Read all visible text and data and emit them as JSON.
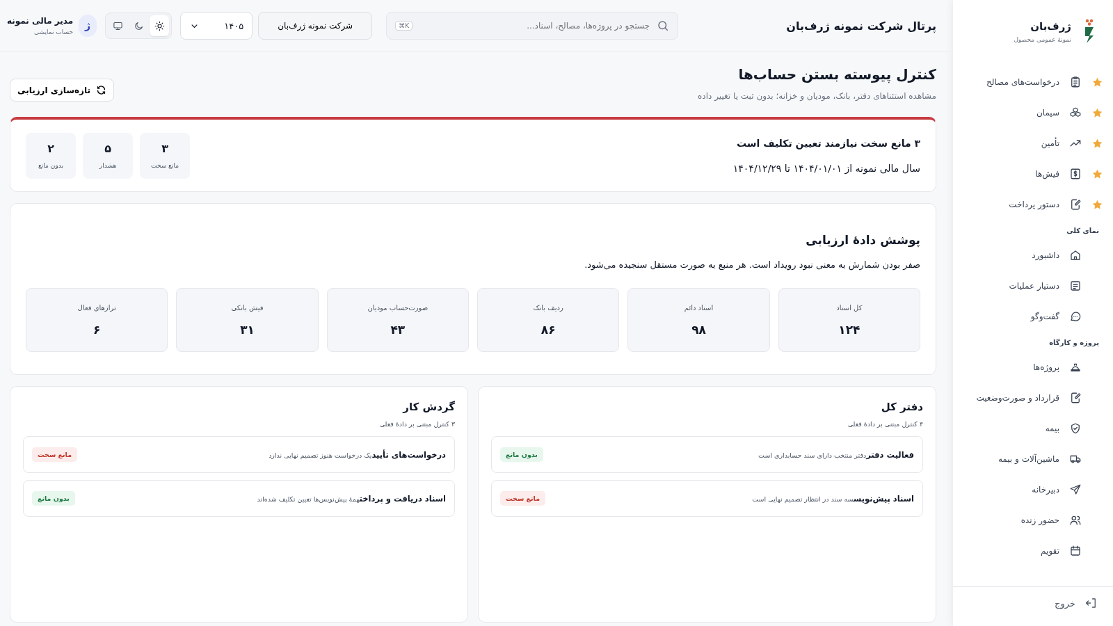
{
  "sidebar": {
    "brand": {
      "name": "ژرف‌بان",
      "tagline": "نمونهٔ عمومی محصول"
    },
    "sections": [
      {
        "items": [
          {
            "label": "درخواست‌های مصالح",
            "starred": true
          },
          {
            "label": "سیمان",
            "starred": true
          },
          {
            "label": "تأمین",
            "starred": true
          },
          {
            "label": "فیش‌ها",
            "starred": true
          },
          {
            "label": "دستور پرداخت",
            "starred": true
          }
        ]
      },
      {
        "title": "نمای کلی",
        "items": [
          {
            "label": "داشبورد",
            "starred": false
          },
          {
            "label": "دستیار عملیات",
            "starred": false
          },
          {
            "label": "گفت‌وگو",
            "starred": false
          }
        ]
      },
      {
        "title": "پروژه و کارگاه",
        "items": [
          {
            "label": "پروژه‌ها",
            "starred": false
          },
          {
            "label": "قرارداد و صورت‌وضعیت",
            "starred": false
          },
          {
            "label": "بیمه",
            "starred": false
          },
          {
            "label": "ماشین‌آلات و بیمه",
            "starred": false
          },
          {
            "label": "دبیرخانه",
            "starred": false
          },
          {
            "label": "حضور زنده",
            "starred": false
          },
          {
            "label": "تقویم",
            "starred": false
          }
        ]
      }
    ],
    "logout": "خروج"
  },
  "header": {
    "title": "پرتال شرکت نمونه ژرف‌بان",
    "search": {
      "placeholder": "جستجو در پروژه‌ها، مصالح، اسناد...",
      "shortcut": "⌘K"
    },
    "company": "شرکت نمونه ژرف‌بان",
    "year": "۱۴۰۵",
    "theme_options": [
      {
        "selected": true
      },
      {
        "selected": false
      },
      {
        "selected": false
      }
    ],
    "user": {
      "avatar": "ژ",
      "name": "مدیر مالی نمونه",
      "role": "حساب نمایشی"
    }
  },
  "page": {
    "title": "کنترل پیوسته بستن حساب‌ها",
    "subtitle": "مشاهده استثناهای دفتر، بانک، مودیان و خزانه؛ بدون ثبت یا تغییر داده",
    "refresh_button": "تازه‌سازی ارزیابی"
  },
  "alert": {
    "title": "۳ مانع سخت نیازمند تعیین تکلیف است",
    "period": "سال مالی نمونه از ۱۴۰۴/۰۱/۰۱ تا ۱۴۰۴/۱۲/۲۹",
    "stats": [
      {
        "value": "۳",
        "label": "مانع سخت"
      },
      {
        "value": "۵",
        "label": "هشدار"
      },
      {
        "value": "۲",
        "label": "بدون مانع"
      }
    ]
  },
  "coverage": {
    "title": "پوشش دادهٔ ارزیابی",
    "description": "صفر بودن شمارش به معنی نبود رویداد است. هر منبع به صورت مستقل سنجیده می‌شود.",
    "tiles": [
      {
        "label": "کل اسناد",
        "value": "۱۲۴"
      },
      {
        "label": "اسناد دائم",
        "value": "۹۸"
      },
      {
        "label": "ردیف بانک",
        "value": "۸۶"
      },
      {
        "label": "صورت‌حساب مودیان",
        "value": "۴۳"
      },
      {
        "label": "فیش بانکی",
        "value": "۳۱"
      },
      {
        "label": "ترازهای فعال",
        "value": "۶"
      }
    ]
  },
  "groups": [
    {
      "title": "دفتر کل",
      "subtitle": "۴ کنترل مبتنی بر دادهٔ فعلی",
      "controls": [
        {
          "title": "فعالیت دفتر",
          "detail": "دفتر منتخب دارای سند حسابداری است",
          "kind": "clear",
          "badge": "بدون مانع"
        },
        {
          "title": "اسناد پیش‌نویس",
          "detail": "سه سند در انتظار تصمیم نهایی است",
          "kind": "hard",
          "badge": "مانع سخت"
        }
      ]
    },
    {
      "title": "گردش کار",
      "subtitle": "۳ کنترل مبتنی بر دادهٔ فعلی",
      "controls": [
        {
          "title": "درخواست‌های تأیید",
          "detail": "یک درخواست هنوز تصمیم نهایی ندارد",
          "kind": "hard",
          "badge": "مانع سخت"
        },
        {
          "title": "اسناد دریافت و پرداخت",
          "detail": "همهٔ پیش‌نویس‌ها تعیین تکلیف شده‌اند",
          "kind": "clear",
          "badge": "بدون مانع"
        }
      ]
    }
  ]
}
